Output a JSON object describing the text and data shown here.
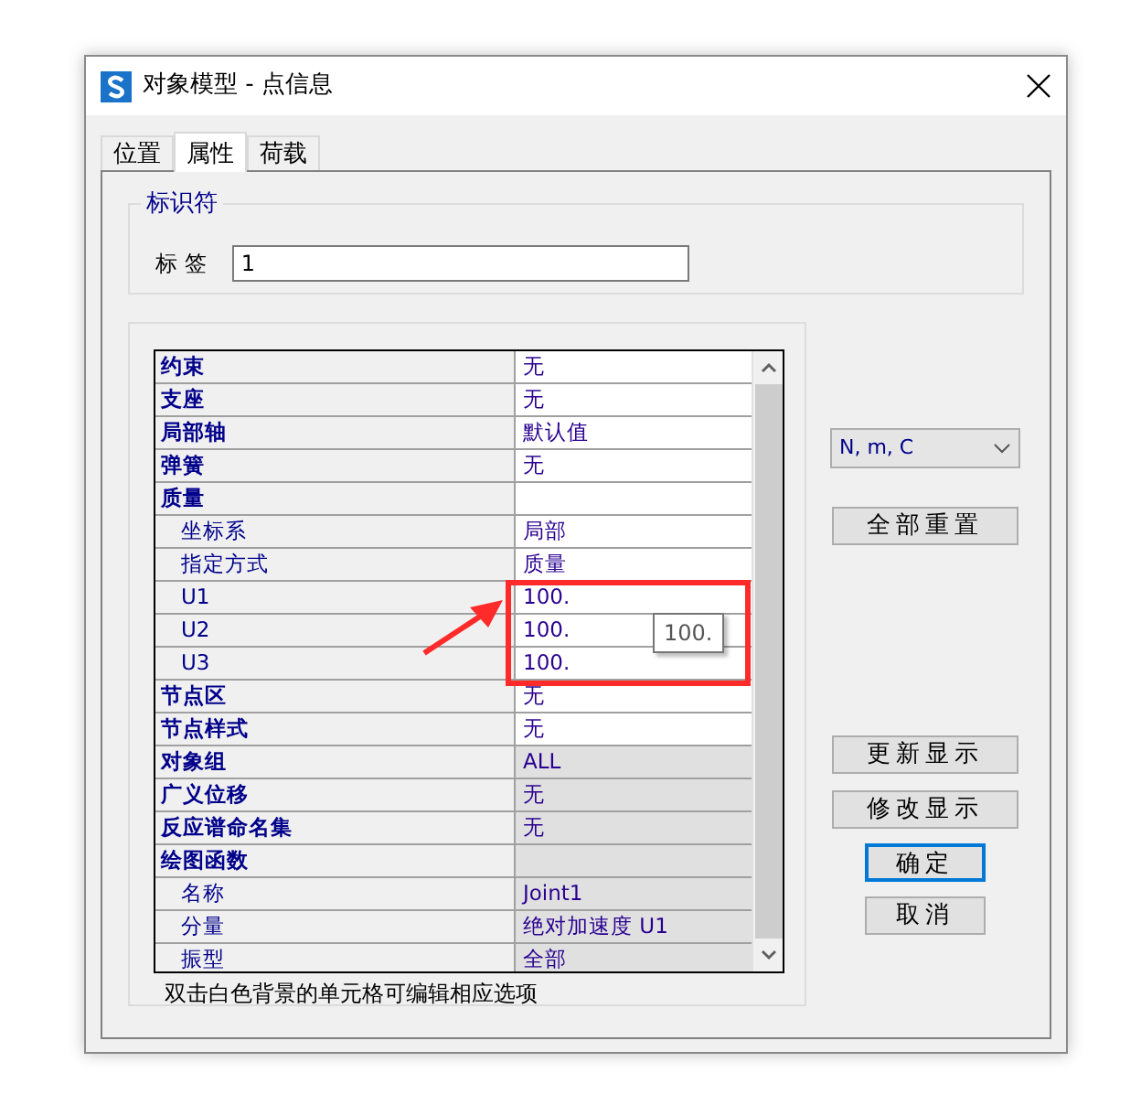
{
  "window": {
    "title": "对象模型 - 点信息"
  },
  "tabs": [
    {
      "label": "位置",
      "selected": false
    },
    {
      "label": "属性",
      "selected": true
    },
    {
      "label": "荷载",
      "selected": false
    }
  ],
  "identifier": {
    "legend": "标识符",
    "label": "标 签",
    "value": "1"
  },
  "properties": [
    {
      "name": "约束",
      "kind": "group",
      "value": "无",
      "editable": true
    },
    {
      "name": "支座",
      "kind": "group",
      "value": "无",
      "editable": true
    },
    {
      "name": "局部轴",
      "kind": "group",
      "value": "默认值",
      "editable": true
    },
    {
      "name": "弹簧",
      "kind": "group",
      "value": "无",
      "editable": true
    },
    {
      "name": "质量",
      "kind": "group",
      "editable": true
    },
    {
      "name": "坐标系",
      "kind": "item",
      "value": "局部",
      "editable": true
    },
    {
      "name": "指定方式",
      "kind": "item",
      "value": "质量",
      "editable": true
    },
    {
      "name": "U1",
      "kind": "item",
      "value": "100.",
      "editable": true
    },
    {
      "name": "U2",
      "kind": "item",
      "value": "100.",
      "editable": true
    },
    {
      "name": "U3",
      "kind": "item",
      "value": "100.",
      "editable": true
    },
    {
      "name": "节点区",
      "kind": "group",
      "value": "无",
      "editable": true
    },
    {
      "name": "节点样式",
      "kind": "group",
      "value": "无",
      "editable": true
    },
    {
      "name": "对象组",
      "kind": "group",
      "value": "ALL",
      "editable": false
    },
    {
      "name": "广义位移",
      "kind": "group",
      "value": "无",
      "editable": false
    },
    {
      "name": "反应谱命名集",
      "kind": "group",
      "value": "无",
      "editable": false
    },
    {
      "name": "绘图函数",
      "kind": "group",
      "editable": false
    },
    {
      "name": "名称",
      "kind": "item",
      "value": "Joint1",
      "editable": false
    },
    {
      "name": "分量",
      "kind": "item",
      "value": "绝对加速度 U1",
      "editable": false
    },
    {
      "name": "振型",
      "kind": "item",
      "value": "全部",
      "editable": false
    }
  ],
  "tooltip": "100.",
  "hint": "双击白色背景的单元格可编辑相应选项",
  "units": {
    "value": "N, m, C"
  },
  "buttons": [
    {
      "label": "全部重置",
      "kind": "wide",
      "default": false
    },
    {
      "label": "更新显示",
      "kind": "wide",
      "default": false
    },
    {
      "label": "修改显示",
      "kind": "wide",
      "default": false
    },
    {
      "label": "确定",
      "kind": "narrow",
      "default": true
    },
    {
      "label": "取消",
      "kind": "narrow",
      "default": false
    }
  ]
}
